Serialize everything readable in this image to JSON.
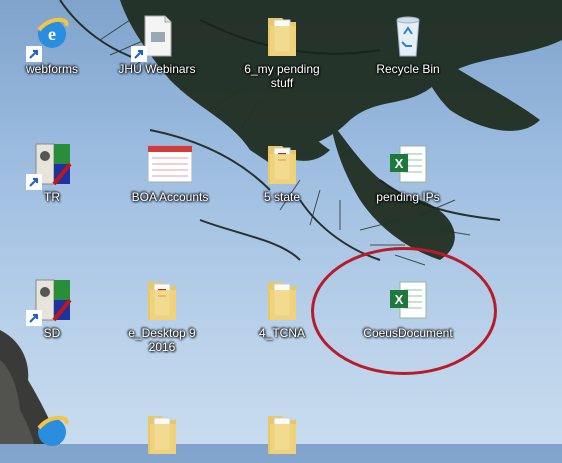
{
  "desktop": {
    "icons": [
      {
        "label": "webforms",
        "icon": "ie-shortcut-icon"
      },
      {
        "label": "JHU Webinars",
        "icon": "document-shortcut-icon"
      },
      {
        "label": "6_my pending stuff",
        "icon": "folder-icon"
      },
      {
        "label": "Recycle Bin",
        "icon": "recycle-bin-icon"
      },
      {
        "label": "TR",
        "icon": "app-shortcut-icon"
      },
      {
        "label": "BOA Accounts",
        "icon": "spreadsheet-doc-icon"
      },
      {
        "label": "5 state",
        "icon": "folder-icon"
      },
      {
        "label": "pending IPs",
        "icon": "excel-icon"
      },
      {
        "label": "SD",
        "icon": "app-shortcut-icon"
      },
      {
        "label": "e_Desktop 9 2016",
        "icon": "folder-icon"
      },
      {
        "label": "4_TCNA",
        "icon": "folder-icon"
      },
      {
        "label": "CoeusDocument",
        "icon": "excel-icon"
      },
      {
        "label": "",
        "icon": "ie-shortcut-icon"
      },
      {
        "label": "",
        "icon": "folder-icon"
      },
      {
        "label": "",
        "icon": "folder-icon"
      }
    ],
    "annotation": {
      "shape": "ellipse",
      "color": "#b71c2a",
      "target": "CoeusDocument"
    }
  }
}
